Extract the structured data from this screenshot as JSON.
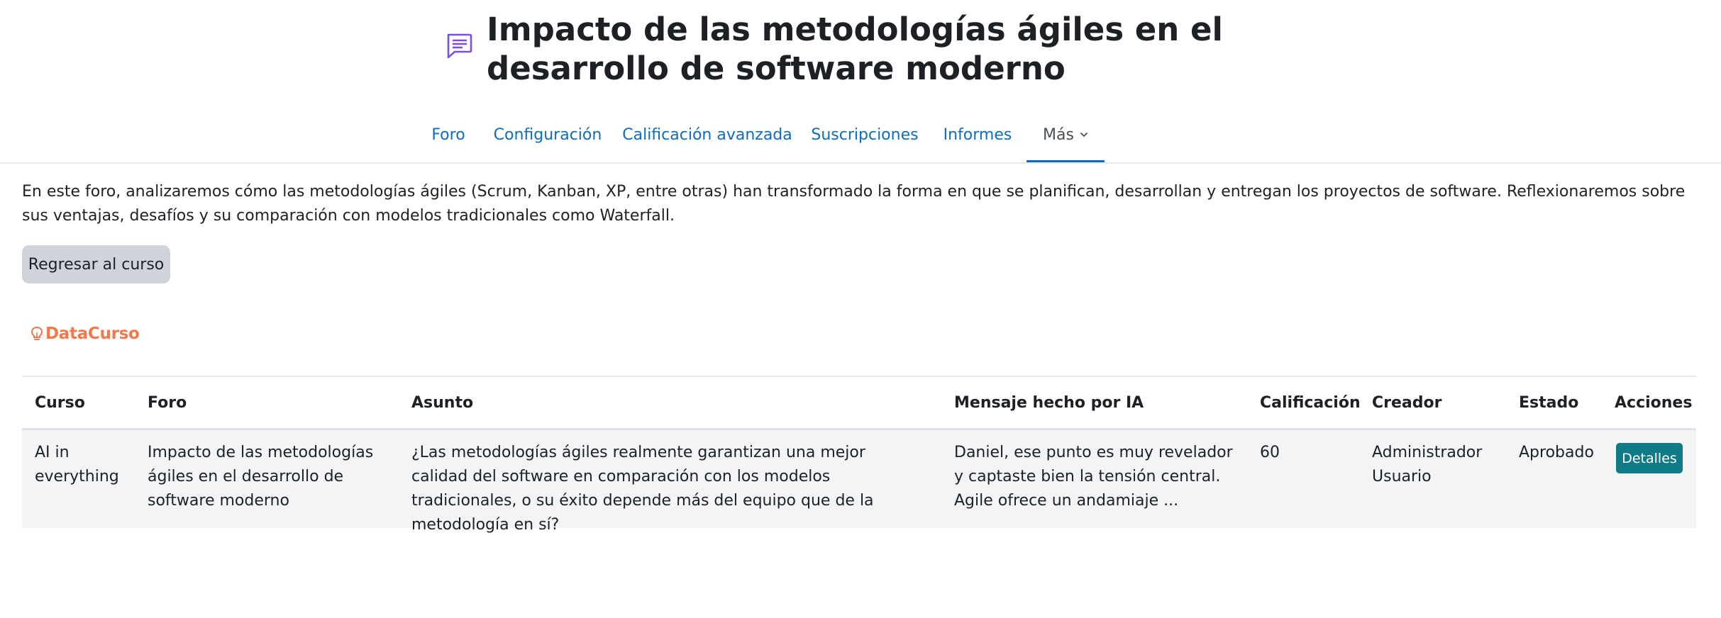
{
  "header": {
    "title": "Impacto de las metodologías ágiles en el desarrollo de software moderno",
    "title_icon": "forum-chat-icon"
  },
  "tabs": [
    {
      "label": "Foro",
      "active": false
    },
    {
      "label": "Configuración",
      "active": false
    },
    {
      "label": "Calificación avanzada",
      "active": false
    },
    {
      "label": "Suscripciones",
      "active": false
    },
    {
      "label": "Informes",
      "active": false
    },
    {
      "label": "Más",
      "active": true
    }
  ],
  "intro": {
    "text": "En este foro, analizaremos cómo las metodologías ágiles (Scrum, Kanban, XP, entre otras) han transformado la forma en que se planifican, desarrollan y entregan los proyectos de software. Reflexionaremos sobre sus ventajas, desafíos y su comparación con modelos tradicionales como Waterfall."
  },
  "back_button": {
    "label": "Regresar al curso"
  },
  "brand": {
    "name": "DataCurso",
    "color": "#f2784b"
  },
  "table": {
    "columns": [
      "Curso",
      "Foro",
      "Asunto",
      "Mensaje hecho por IA",
      "Calificación",
      "Creador",
      "Estado",
      "Acciones"
    ],
    "rows": [
      {
        "curso": "AI in everything",
        "foro": "Impacto de las metodologías ágiles en el desarrollo de software moderno",
        "asunto": "¿Las metodologías ágiles realmente garantizan una mejor calidad del software en comparación con los modelos tradicionales, o su éxito depende más del equipo que de la metodología en sí?",
        "mensaje": "Daniel, ese punto es muy revelador y captaste bien la tensión central. Agile ofrece un andamiaje ...",
        "calificacion": "60",
        "creador": "Administrador Usuario",
        "estado": "Aprobado",
        "accion": "Detalles"
      }
    ]
  },
  "colors": {
    "link": "#0f6cbf",
    "accent_button": "#107b87",
    "secondary_button": "#ced4da",
    "row_bg": "#f3f4f5"
  }
}
